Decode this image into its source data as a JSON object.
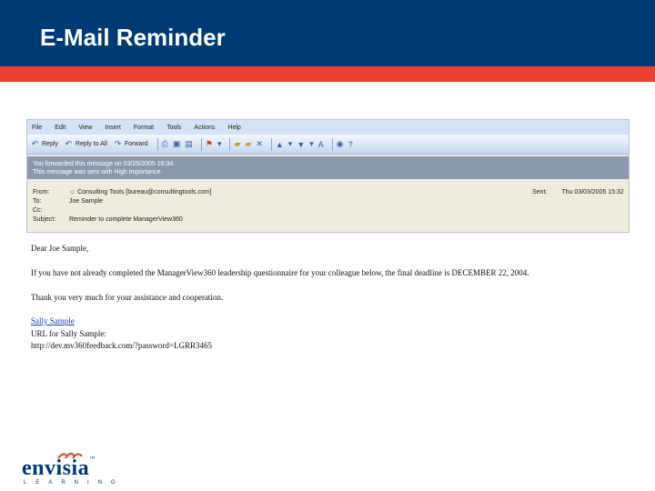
{
  "page": {
    "title": "E-Mail Reminder"
  },
  "outlook": {
    "menu": [
      "File",
      "Edit",
      "View",
      "Insert",
      "Format",
      "Tools",
      "Actions",
      "Help"
    ],
    "toolbar": {
      "reply": "Reply",
      "reply_all": "Reply to All",
      "forward": "Forward"
    },
    "info_bar": {
      "line1": "You forwarded this message on 03/25/2005 16:34.",
      "line2": "This message was sent with High importance."
    },
    "headers": {
      "from_label": "From:",
      "from_value": "Consulting Tools [bureau@consultingtools.com]",
      "to_label": "To:",
      "to_value": "Joe Sample",
      "cc_label": "Cc:",
      "cc_value": "",
      "subject_label": "Subject:",
      "subject_value": "Reminder to complete ManagerView360",
      "sent_label": "Sent:",
      "sent_value": "Thu 03/03/2005 15:32"
    }
  },
  "email": {
    "greeting": "Dear Joe Sample,",
    "paragraph1": "If you have not already completed the ManagerView360 leadership questionnaire for your colleague below, the final deadline is DECEMBER 22, 2004.",
    "paragraph2": "Thank you very much for your assistance and cooperation.",
    "colleague_link": "Sally Sample",
    "url_label": "URL for Sally Sample:",
    "url": "http://dev.mv360feedback.com/?password=LGRR3465"
  },
  "logo": {
    "name": "envisia",
    "sub": "LEARNING"
  }
}
